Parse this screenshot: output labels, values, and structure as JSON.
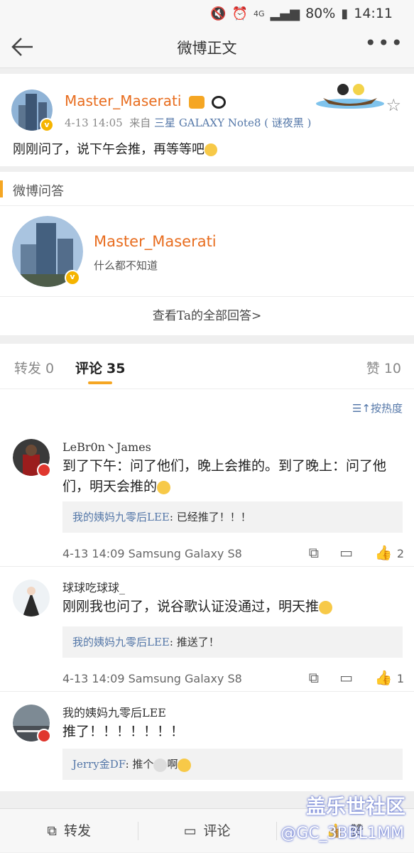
{
  "status_bar": {
    "battery": "80%",
    "time": "14:11",
    "network": "4G"
  },
  "nav": {
    "title": "微博正文"
  },
  "post": {
    "author": "Master_Maserati",
    "time": "4-13 14:05",
    "from_label": "来自",
    "source": "三星 GALAXY Note8 ( 谜夜黑 )",
    "text": "刚刚问了，说下午会推，再等等吧"
  },
  "qa": {
    "section_title": "微博问答",
    "user_name": "Master_Maserati",
    "user_desc": "什么都不知道",
    "view_all": "查看Ta的全部回答>"
  },
  "tabs": {
    "repost_label": "转发",
    "repost_count": "0",
    "comment_label": "评论",
    "comment_count": "35",
    "like_label": "赞",
    "like_count": "10"
  },
  "sort": {
    "label": "按热度"
  },
  "comments": [
    {
      "name": "LeBr0n丶James",
      "text": "到了下午：问了他们，晚上会推的。到了晚上：问了他们，明天会推的",
      "reply_user": "我的姨妈九零后LEE",
      "reply_text": ": 已经推了！！！",
      "time": "4-13 14:09 Samsung Galaxy S8",
      "likes": "2"
    },
    {
      "name": "球球吃球球_",
      "text": "刚刚我也问了，说谷歌认证没通过，明天推",
      "reply_user": "我的姨妈九零后LEE",
      "reply_text": ": 推送了！",
      "time": "4-13 14:09 Samsung Galaxy S8",
      "likes": "1"
    },
    {
      "name": "我的姨妈九零后LEE",
      "text": "推了！！！！！！！",
      "reply_user": "Jerry金DF",
      "reply_text": ": 推个",
      "reply_text_2": "啊"
    }
  ],
  "toolbar": {
    "repost": "转发",
    "comment": "评论",
    "like": "赞"
  },
  "watermark": {
    "line1": "盖乐世社区",
    "line2": "@GC_3BBL1MM"
  },
  "colors": {
    "accent": "#f5a623",
    "name_orange": "#e86d1f",
    "link_blue": "#5477a8"
  }
}
